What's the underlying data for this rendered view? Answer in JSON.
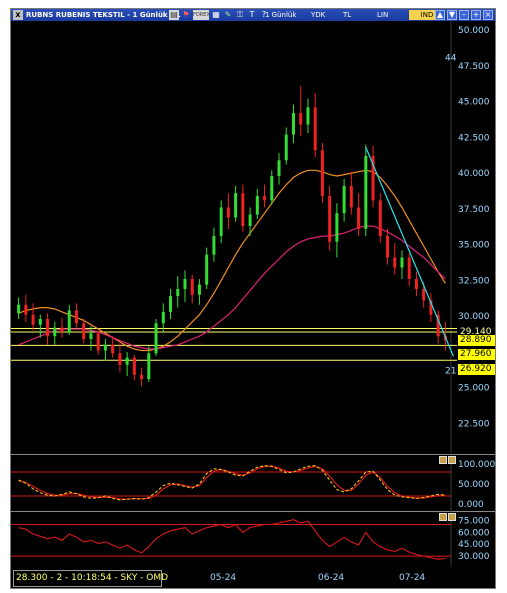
{
  "window": {
    "title": "RUBNS RUBENIS TEKSTIL - 1 Günlük (.1",
    "menu": {
      "period": "1 Günlük",
      "ydk": "YDK",
      "tl": "TL",
      "lin": "LIN",
      "ind": "IND"
    },
    "toolbar_icons": [
      "chart-icon",
      "indicator-icon",
      "forex-icon",
      "grid-icon",
      "pencil-icon",
      "lock-icon",
      "text-icon",
      "question-icon"
    ],
    "window_buttons": [
      "up",
      "down",
      "minimize",
      "maximize",
      "close"
    ]
  },
  "price_axis": {
    "ticks": [
      "50.000",
      "47.500",
      "45.000",
      "42.500",
      "40.000",
      "37.500",
      "35.000",
      "32.500",
      "30.000",
      "25.000",
      "22.500"
    ],
    "extra_labels": [
      "44",
      "21",
      "29.140"
    ],
    "tags": [
      "28.890",
      "27.960",
      "26.920"
    ]
  },
  "stoch_axis": {
    "ticks": [
      "100.000",
      "50.000",
      "0.000"
    ]
  },
  "rsi_axis": {
    "ticks": [
      "75.000",
      "60.000",
      "45.000",
      "30.000"
    ]
  },
  "date_labels": [
    "05-24",
    "06-24",
    "07-24"
  ],
  "status": "28.300 - 2 - 10:18:54 - SKY - OMD",
  "chart_data": [
    {
      "type": "candlestick",
      "ylim": [
        20.5,
        50.5
      ],
      "candles": [
        [
          30.2,
          31.3,
          29.8,
          30.8
        ],
        [
          30.8,
          31.5,
          29.6,
          30.1
        ],
        [
          30.1,
          30.9,
          29.0,
          29.4
        ],
        [
          29.4,
          30.1,
          28.5,
          29.8
        ],
        [
          29.8,
          30.2,
          28.0,
          28.6
        ],
        [
          28.6,
          29.6,
          28.0,
          29.2
        ],
        [
          29.2,
          29.9,
          28.5,
          28.9
        ],
        [
          28.9,
          30.8,
          28.7,
          30.4
        ],
        [
          30.4,
          30.9,
          29.2,
          29.5
        ],
        [
          29.5,
          29.8,
          28.1,
          28.4
        ],
        [
          28.4,
          29.3,
          27.6,
          28.8
        ],
        [
          28.8,
          29.1,
          27.3,
          27.6
        ],
        [
          27.6,
          28.4,
          26.9,
          28.0
        ],
        [
          28.0,
          28.6,
          27.1,
          27.4
        ],
        [
          27.4,
          28.1,
          26.1,
          26.6
        ],
        [
          26.6,
          27.5,
          25.8,
          27.1
        ],
        [
          27.1,
          27.3,
          25.5,
          25.9
        ],
        [
          25.9,
          26.4,
          25.1,
          25.6
        ],
        [
          25.6,
          27.9,
          25.4,
          27.4
        ],
        [
          27.4,
          29.8,
          27.2,
          29.5
        ],
        [
          29.5,
          30.9,
          28.9,
          30.3
        ],
        [
          30.3,
          31.9,
          29.8,
          31.4
        ],
        [
          31.4,
          32.8,
          30.6,
          31.9
        ],
        [
          31.9,
          33.2,
          31.0,
          32.6
        ],
        [
          32.6,
          32.9,
          30.9,
          31.5
        ],
        [
          31.5,
          32.6,
          30.8,
          32.2
        ],
        [
          32.2,
          34.8,
          31.9,
          34.3
        ],
        [
          34.3,
          36.2,
          33.8,
          35.6
        ],
        [
          35.6,
          38.1,
          35.1,
          37.6
        ],
        [
          37.6,
          38.6,
          36.1,
          36.9
        ],
        [
          36.9,
          39.1,
          36.6,
          38.6
        ],
        [
          38.6,
          39.2,
          35.9,
          36.3
        ],
        [
          36.3,
          37.6,
          35.6,
          37.1
        ],
        [
          37.1,
          38.9,
          36.8,
          38.4
        ],
        [
          38.4,
          39.2,
          37.6,
          38.1
        ],
        [
          38.1,
          40.2,
          37.8,
          39.8
        ],
        [
          39.8,
          41.4,
          39.2,
          40.9
        ],
        [
          40.9,
          43.2,
          40.6,
          42.7
        ],
        [
          42.7,
          44.8,
          42.1,
          44.2
        ],
        [
          44.2,
          46.1,
          42.6,
          43.4
        ],
        [
          43.4,
          45.2,
          42.8,
          44.6
        ],
        [
          44.6,
          45.6,
          41.1,
          41.6
        ],
        [
          41.6,
          42.1,
          37.9,
          38.4
        ],
        [
          38.4,
          39.1,
          34.6,
          35.2
        ],
        [
          35.2,
          37.9,
          34.1,
          37.2
        ],
        [
          37.2,
          39.6,
          36.6,
          39.1
        ],
        [
          39.1,
          40.1,
          37.1,
          37.6
        ],
        [
          37.6,
          38.6,
          35.6,
          36.1
        ],
        [
          36.1,
          42.0,
          35.6,
          41.2
        ],
        [
          41.2,
          41.9,
          37.6,
          38.1
        ],
        [
          38.1,
          38.6,
          35.1,
          35.6
        ],
        [
          35.6,
          36.1,
          33.6,
          34.1
        ],
        [
          34.1,
          35.1,
          32.9,
          33.4
        ],
        [
          33.4,
          34.6,
          32.6,
          34.1
        ],
        [
          34.1,
          34.4,
          32.1,
          32.6
        ],
        [
          32.6,
          33.1,
          31.4,
          31.9
        ],
        [
          31.9,
          32.4,
          30.6,
          31.1
        ],
        [
          31.1,
          31.6,
          29.6,
          30.1
        ],
        [
          30.1,
          30.4,
          28.1,
          28.6
        ],
        [
          28.6,
          29.6,
          27.6,
          28.3
        ]
      ],
      "ma_short": [
        30.2,
        30.4,
        30.5,
        30.6,
        30.6,
        30.5,
        30.3,
        30.1,
        29.9,
        29.7,
        29.4,
        29.1,
        28.8,
        28.5,
        28.2,
        27.9,
        27.7,
        27.6,
        27.6,
        27.7,
        27.9,
        28.2,
        28.6,
        29.1,
        29.6,
        30.1,
        30.8,
        31.6,
        32.5,
        33.4,
        34.3,
        35.1,
        35.8,
        36.5,
        37.2,
        37.9,
        38.6,
        39.2,
        39.7,
        40.0,
        40.2,
        40.2,
        40.1,
        39.9,
        39.8,
        39.9,
        40.0,
        40.1,
        40.2,
        40.1,
        39.7,
        39.1,
        38.4,
        37.6,
        36.7,
        35.8,
        34.9,
        34.0,
        33.1,
        32.3
      ],
      "ma_long": [
        28.0,
        28.2,
        28.4,
        28.6,
        28.8,
        29.0,
        29.1,
        29.1,
        29.1,
        29.1,
        29.0,
        28.9,
        28.7,
        28.5,
        28.3,
        28.1,
        27.9,
        27.8,
        27.7,
        27.7,
        27.8,
        27.9,
        28.0,
        28.2,
        28.4,
        28.6,
        28.9,
        29.3,
        29.7,
        30.1,
        30.6,
        31.2,
        31.8,
        32.4,
        33.0,
        33.5,
        34.0,
        34.5,
        34.9,
        35.2,
        35.4,
        35.5,
        35.6,
        35.6,
        35.7,
        35.8,
        36.0,
        36.2,
        36.3,
        36.3,
        36.1,
        35.9,
        35.6,
        35.3,
        34.9,
        34.5,
        34.1,
        33.6,
        33.1,
        32.6
      ],
      "horizontal_levels": [
        29.14,
        28.89,
        27.96,
        26.92
      ],
      "trendline": {
        "from": [
          48,
          41.8
        ],
        "to": [
          59,
          27.2
        ]
      }
    },
    {
      "type": "line",
      "name": "stochastic",
      "ylim": [
        -10,
        115
      ],
      "levels": [
        80,
        20
      ],
      "fast": [
        60,
        52,
        38,
        28,
        22,
        20,
        24,
        30,
        26,
        18,
        14,
        16,
        20,
        14,
        10,
        12,
        14,
        12,
        16,
        30,
        46,
        52,
        48,
        44,
        40,
        50,
        76,
        88,
        86,
        80,
        72,
        70,
        82,
        92,
        96,
        94,
        86,
        78,
        80,
        88,
        94,
        96,
        84,
        60,
        36,
        30,
        38,
        58,
        80,
        82,
        60,
        36,
        22,
        18,
        16,
        14,
        16,
        20,
        24,
        22
      ],
      "slow": [
        58,
        54,
        44,
        34,
        26,
        22,
        22,
        26,
        26,
        22,
        18,
        16,
        17,
        16,
        13,
        12,
        13,
        13,
        14,
        22,
        38,
        48,
        50,
        46,
        42,
        46,
        66,
        82,
        86,
        82,
        76,
        72,
        78,
        88,
        94,
        95,
        90,
        82,
        80,
        84,
        90,
        94,
        88,
        70,
        48,
        34,
        34,
        50,
        72,
        80,
        66,
        44,
        28,
        20,
        17,
        15,
        15,
        18,
        21,
        22
      ]
    },
    {
      "type": "line",
      "name": "rsi",
      "ylim": [
        20,
        82
      ],
      "levels": [
        70,
        30
      ],
      "values": [
        66,
        64,
        58,
        55,
        52,
        54,
        50,
        58,
        54,
        48,
        50,
        46,
        48,
        44,
        40,
        44,
        38,
        34,
        42,
        52,
        58,
        62,
        64,
        66,
        58,
        62,
        66,
        68,
        70,
        66,
        70,
        60,
        66,
        68,
        70,
        70,
        72,
        74,
        76,
        72,
        74,
        62,
        50,
        42,
        48,
        54,
        48,
        44,
        60,
        48,
        42,
        38,
        36,
        40,
        35,
        32,
        30,
        28,
        26,
        27
      ]
    }
  ]
}
